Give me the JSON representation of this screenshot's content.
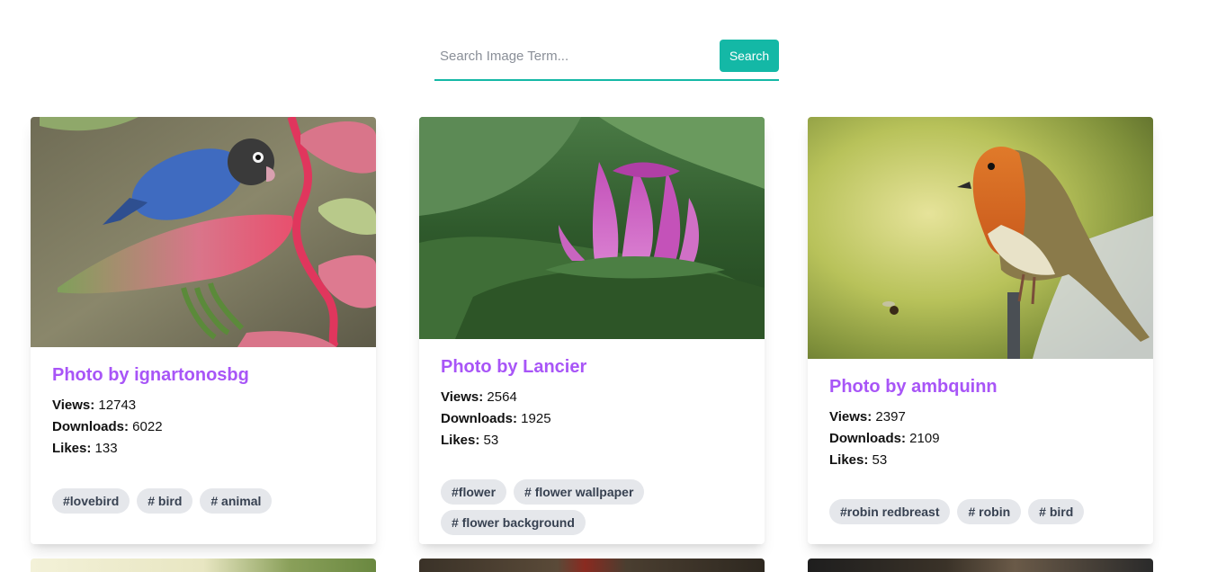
{
  "search": {
    "placeholder": "Search Image Term...",
    "button_label": "Search"
  },
  "colors": {
    "accent": "#14b8a6",
    "title": "#a855f7",
    "tag_bg": "#e5e7eb"
  },
  "labels": {
    "views": "Views:",
    "downloads": "Downloads:",
    "likes": "Likes:"
  },
  "cards": [
    {
      "title": "Photo by ignartonosbg",
      "views": "12743",
      "downloads": "6022",
      "likes": "133",
      "tags": [
        "#lovebird",
        "# bird",
        "# animal"
      ],
      "image": "lovebird-photo"
    },
    {
      "title": "Photo by Lancier",
      "views": "2564",
      "downloads": "1925",
      "likes": "53",
      "tags": [
        "#flower",
        "# flower wallpaper",
        "# flower background"
      ],
      "image": "lotus-photo"
    },
    {
      "title": "Photo by ambquinn",
      "views": "2397",
      "downloads": "2109",
      "likes": "53",
      "tags": [
        "#robin redbreast",
        "# robin",
        "# bird"
      ],
      "image": "robin-photo"
    }
  ]
}
